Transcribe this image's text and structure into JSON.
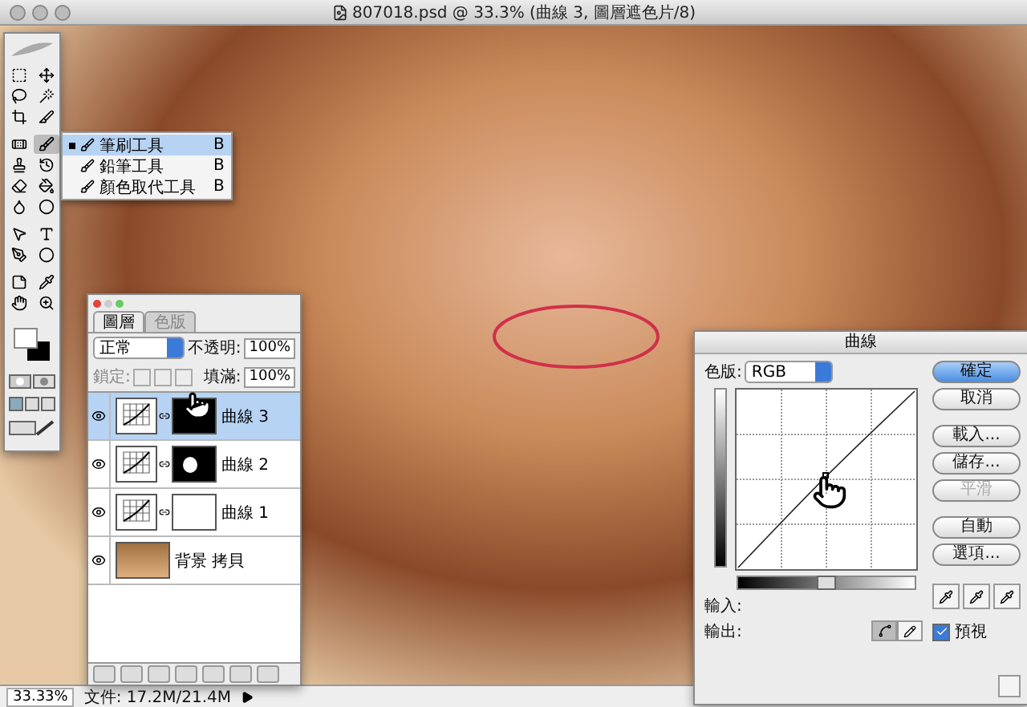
{
  "window": {
    "title": "807018.psd @ 33.3% (曲線 3, 圖層遮色片/8)"
  },
  "tool_flyout": {
    "items": [
      {
        "label": "筆刷工具",
        "shortcut": "B",
        "selected": true
      },
      {
        "label": "鉛筆工具",
        "shortcut": "B",
        "selected": false
      },
      {
        "label": "顏色取代工具",
        "shortcut": "B",
        "selected": false
      }
    ]
  },
  "layers_panel": {
    "tabs": [
      {
        "label": "圖層",
        "selected": true
      },
      {
        "label": "色版",
        "selected": false
      }
    ],
    "blend_mode": "正常",
    "opacity_label": "不透明:",
    "opacity": "100%",
    "lock_label": "鎖定:",
    "fill_label": "填滿:",
    "fill": "100%",
    "layers": [
      {
        "name": "曲線 3",
        "kind": "curves",
        "mask_black": true,
        "mask_spot": false,
        "selected": true,
        "visible": true
      },
      {
        "name": "曲線 2",
        "kind": "curves",
        "mask_black": true,
        "mask_spot": true,
        "selected": false,
        "visible": true
      },
      {
        "name": "曲線 1",
        "kind": "curves",
        "mask_black": false,
        "mask_spot": false,
        "selected": false,
        "visible": true
      },
      {
        "name": "背景 拷貝",
        "kind": "image",
        "selected": false,
        "visible": true
      }
    ]
  },
  "curves_dialog": {
    "title": "曲線",
    "channel_label": "色版:",
    "channel": "RGB",
    "input_label": "輸入:",
    "output_label": "輸出:",
    "buttons": [
      {
        "label": "確定",
        "default": true,
        "disabled": false
      },
      {
        "label": "取消",
        "default": false,
        "disabled": false
      },
      {
        "label": "載入...",
        "default": false,
        "disabled": false
      },
      {
        "label": "儲存...",
        "default": false,
        "disabled": false
      },
      {
        "label": "平滑",
        "default": false,
        "disabled": true
      },
      {
        "label": "自動",
        "default": false,
        "disabled": false
      },
      {
        "label": "選項...",
        "default": false,
        "disabled": false
      }
    ],
    "preview": {
      "label": "預視",
      "checked": true
    }
  },
  "status_bar": {
    "zoom": "33.33%",
    "document": "文件: 17.2M/21.4M"
  }
}
